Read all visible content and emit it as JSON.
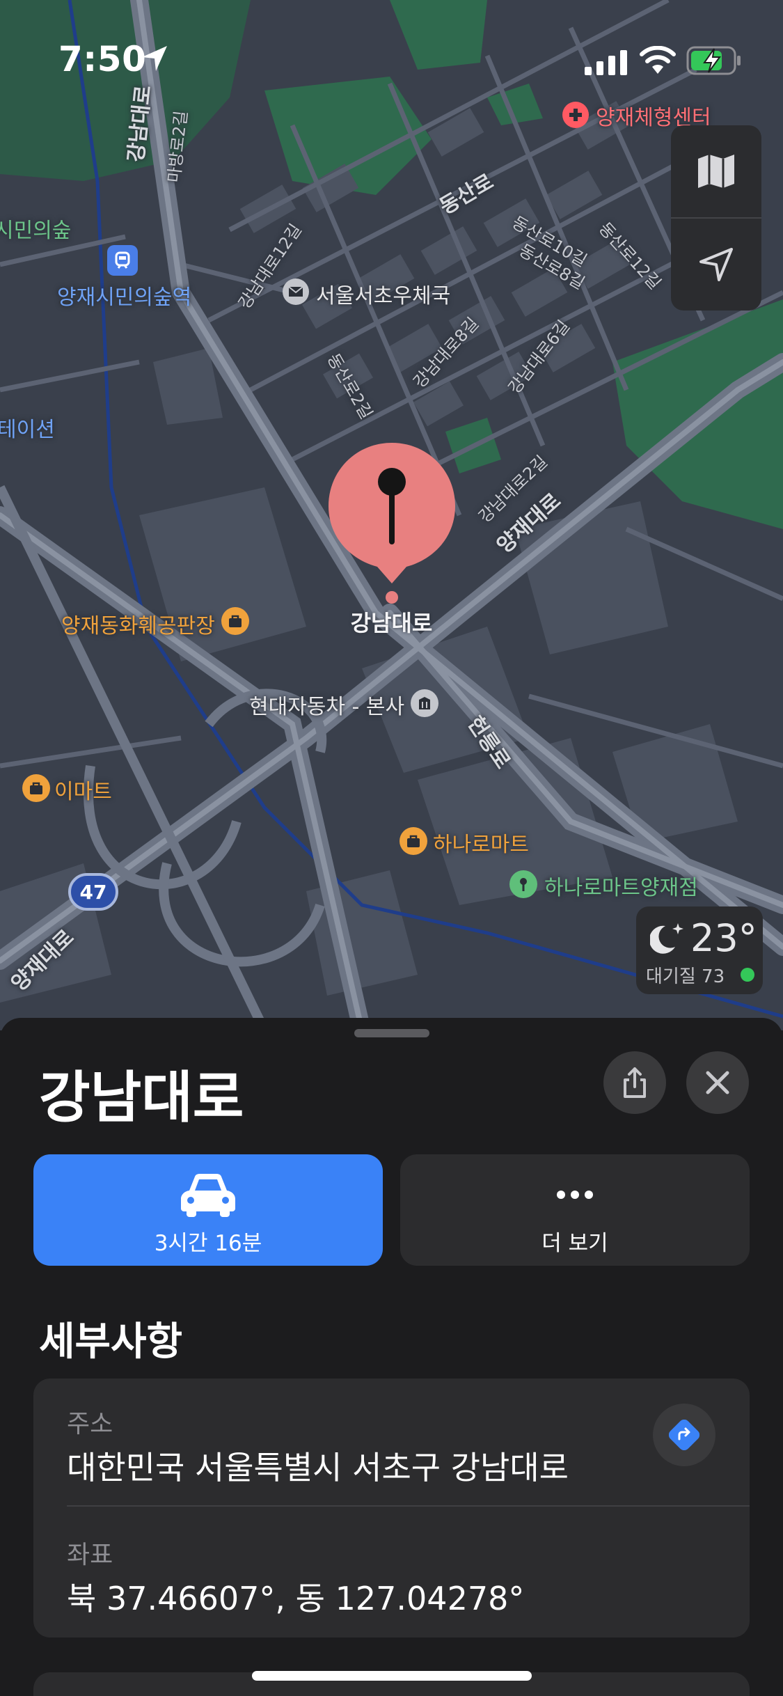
{
  "status_bar": {
    "time": "7:50"
  },
  "map": {
    "labels": {
      "yangjae_rehab_center": "양재체형센터",
      "citizen_forest_partial": "시민의숲",
      "citizen_forest_station": "양재시민의숲역",
      "seocho_post_office": "서울서초우체국",
      "station_partial": "테이션",
      "yangjae_dongwha": "양재동화훼공판장",
      "hyundai_hq": "현대자동차 - 본사",
      "emart": "이마트",
      "hanaro_mart": "하나로마트",
      "hanaro_mart_yangjae": "하나로마트양재점",
      "route_shield": "47"
    },
    "streets": {
      "gangnam_daero_top": "강남대로",
      "mabang_ro_2gil": "마방로2길",
      "dongsan_ro": "동산로",
      "gangnam_daero_12gil": "강남대로12길",
      "dongsan_ro_10gil": "동산로10길",
      "dongsan_ro_8gil": "동산로8길",
      "dongsan_ro_12gil": "동산로12길",
      "gangnam_daero_8gil": "강남대로8길",
      "dongsan_ro_2gil": "동산로2길",
      "gangnam_daero_6gil": "강남대로6길",
      "gangnam_daero_2gil": "강남대로2길",
      "yangjae_daero": "양재대로",
      "heolleung_ro": "헌릉로",
      "yangjae_daero_bottom": "양재대로"
    },
    "pin_label": "강남대로"
  },
  "weather": {
    "temperature": "23°",
    "air_quality": "대기질 73",
    "aqi_color": "#34c759"
  },
  "sheet": {
    "title": "강남대로",
    "directions_label": "3시간 16분",
    "more_label": "더 보기",
    "details_heading": "세부사항",
    "address_label": "주소",
    "address_value": "대한민국 서울특별시 서초구 강남대로",
    "coords_label": "좌표",
    "coords_value": "북 37.46607°, 동 127.04278°"
  },
  "colors": {
    "accent": "#3a82f7",
    "pin": "#e88080",
    "sheet_bg": "#1c1c1e",
    "card_bg": "#2c2c2e"
  },
  "icons": [
    "location-arrow-icon",
    "signal-icon",
    "wifi-icon",
    "battery-charging-icon",
    "map-icon",
    "locate-icon",
    "moon-icon",
    "share-icon",
    "close-icon",
    "car-icon",
    "more-dots-icon",
    "directions-icon",
    "pin-icon"
  ]
}
